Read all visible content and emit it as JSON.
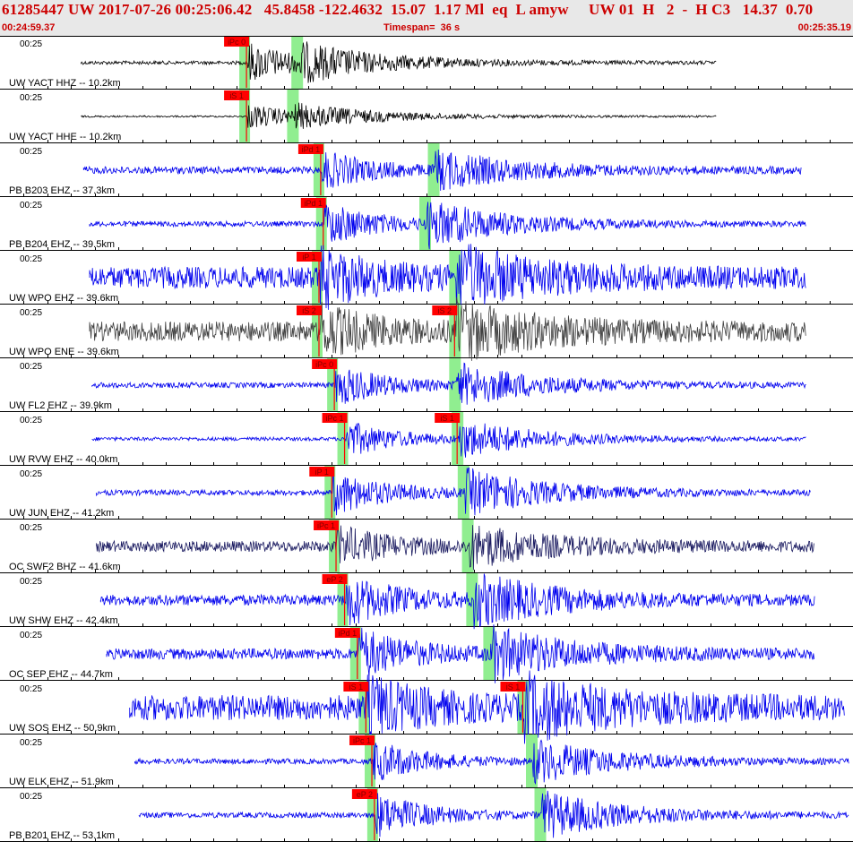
{
  "header": {
    "title": "61285447 UW 2017-07-26 00:25:06.42   45.8458 -122.4632  15.07  1.17 Ml  eq  L amyw     UW 01  H   2  -  H C3   14.37  0.70",
    "start_time": "00:24:59.37",
    "timespan": "Timespan=  36 s",
    "end_time": "00:25:35.19"
  },
  "time_label": "00:25",
  "colors": {
    "trace_blue": "#0000ee",
    "trace_black": "#000000",
    "trace_gray": "#404040",
    "trace_dark": "#1a1a60",
    "pick": "#ff0000",
    "window": "#90ee90",
    "header_bg": "#e8e8e8",
    "header_text": "#cc0000"
  },
  "traces": [
    {
      "label": "UW YACT HHZ -- 10.2km",
      "pick": "iPc 0",
      "color": "black",
      "start": 0.095,
      "end": 0.84,
      "noise": 2,
      "p": 0.29,
      "s": 0.35,
      "amp": 22,
      "spick": ""
    },
    {
      "label": "UW YACT HHE -- 10.2km",
      "pick": "iS 1",
      "color": "black",
      "start": 0.095,
      "end": 0.84,
      "noise": 1,
      "p": 0.29,
      "s": 0.345,
      "amp": 14,
      "spick": ""
    },
    {
      "label": "PB B203 EHZ -- 37.3km",
      "pick": "iPd 1",
      "color": "blue",
      "start": 0.098,
      "end": 0.94,
      "noise": 4,
      "p": 0.377,
      "s": 0.51,
      "amp": 20,
      "spick": ""
    },
    {
      "label": "PB B204 EHZ -- 39.5km",
      "pick": "iPd 1",
      "color": "blue",
      "start": 0.105,
      "end": 0.945,
      "noise": 3,
      "p": 0.38,
      "s": 0.5,
      "amp": 24,
      "spick": ""
    },
    {
      "label": "UW WPO EHZ -- 39.6km",
      "pick": "iP 1",
      "color": "blue",
      "start": 0.105,
      "end": 0.945,
      "noise": 12,
      "p": 0.375,
      "s": 0.535,
      "amp": 28,
      "spick": ""
    },
    {
      "label": "UW WPO ENE -- 39.6km",
      "pick": "iS 2",
      "color": "gray",
      "start": 0.105,
      "end": 0.945,
      "noise": 11,
      "p": 0.375,
      "s": 0.535,
      "amp": 25,
      "spick": "iS 2"
    },
    {
      "label": "UW FL2 EHZ -- 39.9km",
      "pick": "iPc 0",
      "color": "blue",
      "start": 0.108,
      "end": 0.945,
      "noise": 3,
      "p": 0.393,
      "s": 0.535,
      "amp": 22,
      "spick": ""
    },
    {
      "label": "UW RVW EHZ -- 40.0km",
      "pick": "iPc 1",
      "color": "blue",
      "start": 0.108,
      "end": 0.945,
      "noise": 2,
      "p": 0.405,
      "s": 0.538,
      "amp": 20,
      "spick": "iS 1"
    },
    {
      "label": "UW JUN EHZ -- 41.2km",
      "pick": "iP 1",
      "color": "blue",
      "start": 0.113,
      "end": 0.95,
      "noise": 3,
      "p": 0.39,
      "s": 0.545,
      "amp": 24,
      "spick": ""
    },
    {
      "label": "OC SWF2 BHZ -- 41.6km",
      "pick": "iPc 1",
      "color": "dark",
      "start": 0.113,
      "end": 0.955,
      "noise": 6,
      "p": 0.395,
      "s": 0.55,
      "amp": 20,
      "spick": ""
    },
    {
      "label": "UW SHW EHZ -- 42.4km",
      "pick": "eP 2",
      "color": "blue",
      "start": 0.118,
      "end": 0.955,
      "noise": 6,
      "p": 0.405,
      "s": 0.555,
      "amp": 26,
      "spick": ""
    },
    {
      "label": "OC SEP EHZ -- 44.7km",
      "pick": "iPd 1",
      "color": "blue",
      "start": 0.125,
      "end": 0.955,
      "noise": 6,
      "p": 0.42,
      "s": 0.575,
      "amp": 26,
      "spick": ""
    },
    {
      "label": "UW SOS EHZ -- 50.9km",
      "pick": "iS 1",
      "color": "blue",
      "start": 0.152,
      "end": 0.99,
      "noise": 14,
      "p": 0.43,
      "s": 0.615,
      "amp": 28,
      "spick": "iS 1"
    },
    {
      "label": "UW ELK EHZ -- 51.9km",
      "pick": "iPc 1",
      "color": "blue",
      "start": 0.158,
      "end": 0.995,
      "noise": 3,
      "p": 0.437,
      "s": 0.625,
      "amp": 22,
      "spick": ""
    },
    {
      "label": "PB B201 EHZ -- 53.1km",
      "pick": "eP 2",
      "color": "blue",
      "start": 0.163,
      "end": 0.995,
      "noise": 3,
      "p": 0.44,
      "s": 0.635,
      "amp": 24,
      "spick": ""
    }
  ]
}
